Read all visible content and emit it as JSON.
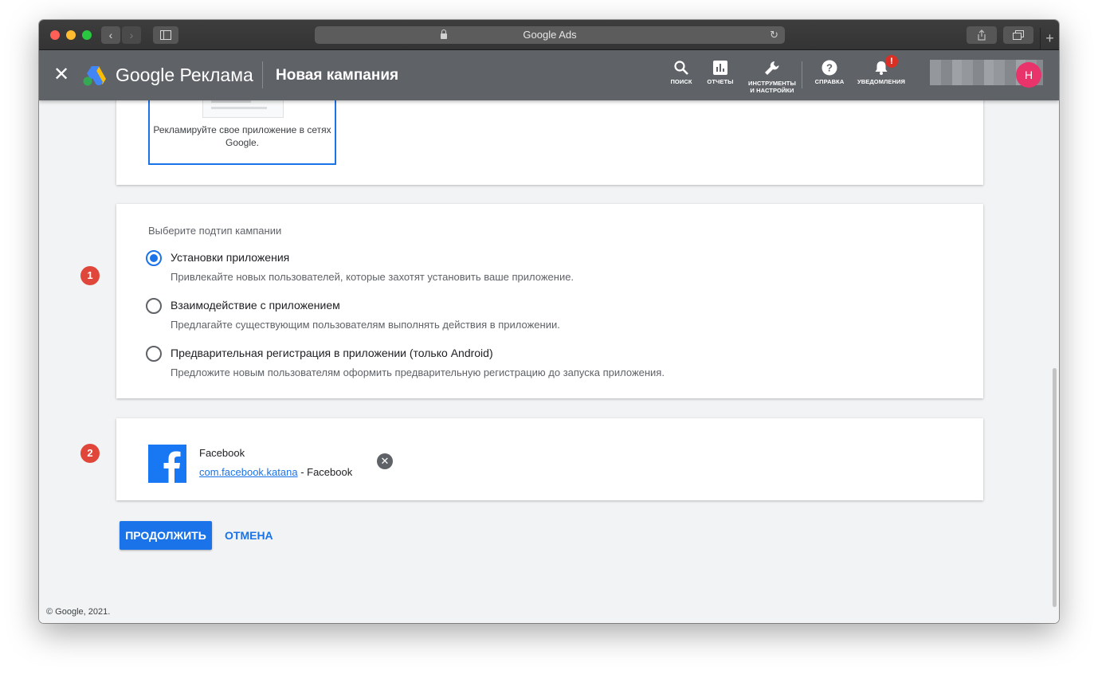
{
  "browser": {
    "address": "Google Ads",
    "new_tab": "+"
  },
  "header": {
    "close": "✕",
    "brand": "Google Реклама",
    "page_title": "Новая кампания",
    "nav": [
      {
        "label": "ПОИСК",
        "icon": "search-icon"
      },
      {
        "label": "ОТЧЕТЫ",
        "icon": "reports-icon"
      },
      {
        "label": "ИНСТРУМЕНТЫ И НАСТРОЙКИ",
        "icon": "wrench-icon"
      },
      {
        "label": "СПРАВКА",
        "icon": "help-icon"
      },
      {
        "label": "УВЕДОМЛЕНИЯ",
        "icon": "bell-icon"
      }
    ],
    "notification_badge": "!",
    "avatar_letter": "Н"
  },
  "campaign_goal": {
    "option_text": "Рекламируйте свое приложение в сетях Google."
  },
  "subtype": {
    "label": "Выберите подтип кампании",
    "badge": "1",
    "options": [
      {
        "title": "Установки приложения",
        "description": "Привлекайте новых пользователей, которые захотят установить ваше приложение.",
        "selected": true
      },
      {
        "title": "Взаимодействие с приложением",
        "description": "Предлагайте существующим пользователям выполнять действия в приложении.",
        "selected": false
      },
      {
        "title": "Предварительная регистрация в приложении (только Android)",
        "description": "Предложите новым пользователям оформить предварительную регистрацию до запуска приложения.",
        "selected": false
      }
    ]
  },
  "app": {
    "badge": "2",
    "name": "Facebook",
    "package": "com.facebook.katana",
    "developer": " - Facebook",
    "remove": "✕"
  },
  "actions": {
    "continue": "ПРОДОЛЖИТЬ",
    "cancel": "ОТМЕНА"
  },
  "footer": "© Google, 2021.",
  "colors": {
    "accent": "#1a73e8",
    "header_bg": "#5f6368",
    "badge": "#e0473a"
  }
}
